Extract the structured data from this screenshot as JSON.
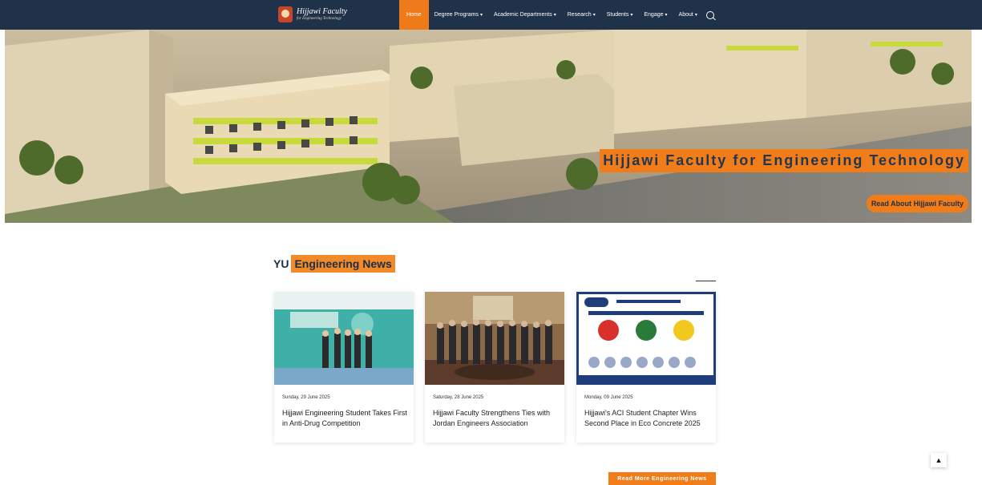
{
  "navbar": {
    "logo_title": "Hijjawi Faculty",
    "logo_subtitle": "for Engineering Technology",
    "items": [
      {
        "label": "Home",
        "active": true
      },
      {
        "label": "Degree Programs",
        "dropdown": true
      },
      {
        "label": "Academic Departments",
        "dropdown": true
      },
      {
        "label": "Research",
        "dropdown": true
      },
      {
        "label": "Students",
        "dropdown": true
      },
      {
        "label": "Engage",
        "dropdown": true
      },
      {
        "label": "About",
        "dropdown": true
      }
    ],
    "search_icon": "search-icon"
  },
  "hero": {
    "title": "Hijjawi Faculty for Engineering Technology",
    "button_label": "Read About Hijjawi Faculty"
  },
  "news": {
    "prefix": "YU",
    "title": "Engineering News",
    "cards": [
      {
        "date": "Sunday, 29 June 2025",
        "title": "Hijjawi Engineering Student Takes First in Anti-Drug Competition"
      },
      {
        "date": "Saturday, 28 June 2025",
        "title": "Hijjawi Faculty Strengthens Ties with Jordan Engineers Association"
      },
      {
        "date": "Monday, 09 June 2025",
        "title": "Hijjawi's ACI Student Chapter Wins Second Place in Eco Concrete 2025"
      }
    ],
    "more_button": "Read More Engineering News"
  },
  "colors": {
    "navbar": "#20324a",
    "accent": "#f07d1a"
  }
}
